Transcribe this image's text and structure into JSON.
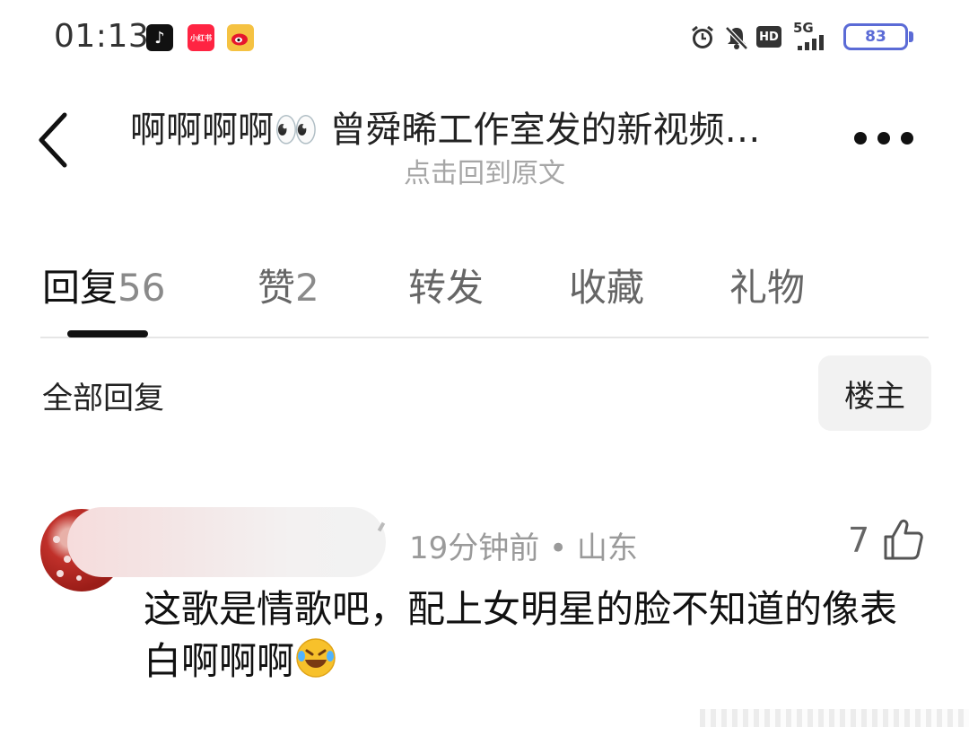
{
  "status_bar": {
    "time": "01:13",
    "apps": [
      "tiktok-icon",
      "xiaohongshu-icon",
      "weibo-icon"
    ],
    "xhs_label": "小红书",
    "hd_label": "HD",
    "network": "5G",
    "battery": "83"
  },
  "header": {
    "title": "啊啊啊啊👀 曾舜晞工作室发的新视频…",
    "subtitle": "点击回到原文"
  },
  "tabs": [
    {
      "label": "回复",
      "count": "56"
    },
    {
      "label": "赞",
      "count": "2"
    },
    {
      "label": "转发",
      "count": ""
    },
    {
      "label": "收藏",
      "count": ""
    },
    {
      "label": "礼物",
      "count": ""
    }
  ],
  "filter": {
    "label": "全部回复",
    "op_button": "楼主"
  },
  "comment": {
    "meta": "19分钟前 • 山东",
    "likes": "7",
    "text": "这歌是情歌吧，配上女明星的脸不知道的像表白啊啊啊"
  },
  "colors": {
    "accent_battery": "#5b6bd6",
    "tab_indicator": "#111111",
    "subtitle_gray": "#a6a6a6"
  }
}
